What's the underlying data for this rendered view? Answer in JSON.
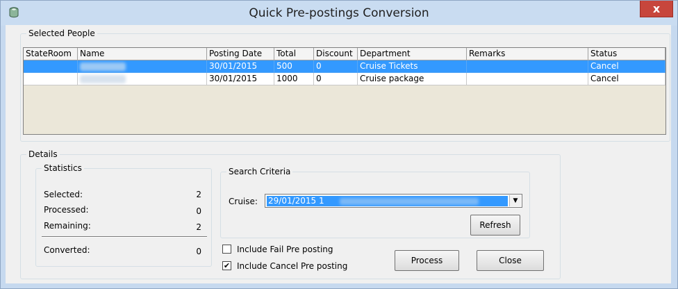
{
  "window": {
    "title": "Quick Pre-postings Conversion",
    "close_label": "x",
    "icon": "database-icon"
  },
  "selected_people": {
    "label": "Selected People",
    "columns": [
      "StateRoom",
      "Name",
      "Posting Date",
      "Total",
      "Discount",
      "Department",
      "Remarks",
      "Status"
    ],
    "rows": [
      {
        "stateroom": "",
        "name": "",
        "posting_date": "30/01/2015",
        "total": "500",
        "discount": "0",
        "department": "Cruise Tickets",
        "remarks": "",
        "status": "Cancel",
        "selected": true
      },
      {
        "stateroom": "",
        "name": "",
        "posting_date": "30/01/2015",
        "total": "1000",
        "discount": "0",
        "department": "Cruise package",
        "remarks": "",
        "status": "Cancel",
        "selected": false
      }
    ]
  },
  "details": {
    "label": "Details",
    "statistics": {
      "label": "Statistics",
      "selected_label": "Selected:",
      "selected_value": "2",
      "processed_label": "Processed:",
      "processed_value": "0",
      "remaining_label": "Remaining:",
      "remaining_value": "2",
      "converted_label": "Converted:",
      "converted_value": "0"
    },
    "search_criteria": {
      "label": "Search Criteria",
      "cruise_label": "Cruise:",
      "cruise_value": "29/01/2015  1",
      "refresh_label": "Refresh"
    },
    "include_fail_label": "Include Fail Pre posting",
    "include_fail_checked": false,
    "include_cancel_label": "Include Cancel Pre posting",
    "include_cancel_checked": true,
    "process_label": "Process",
    "close_label": "Close"
  },
  "colors": {
    "selection": "#3399ff",
    "title_bar": "#c9dcf1",
    "close_button": "#c7463c",
    "grid_empty": "#ebe7d9"
  }
}
